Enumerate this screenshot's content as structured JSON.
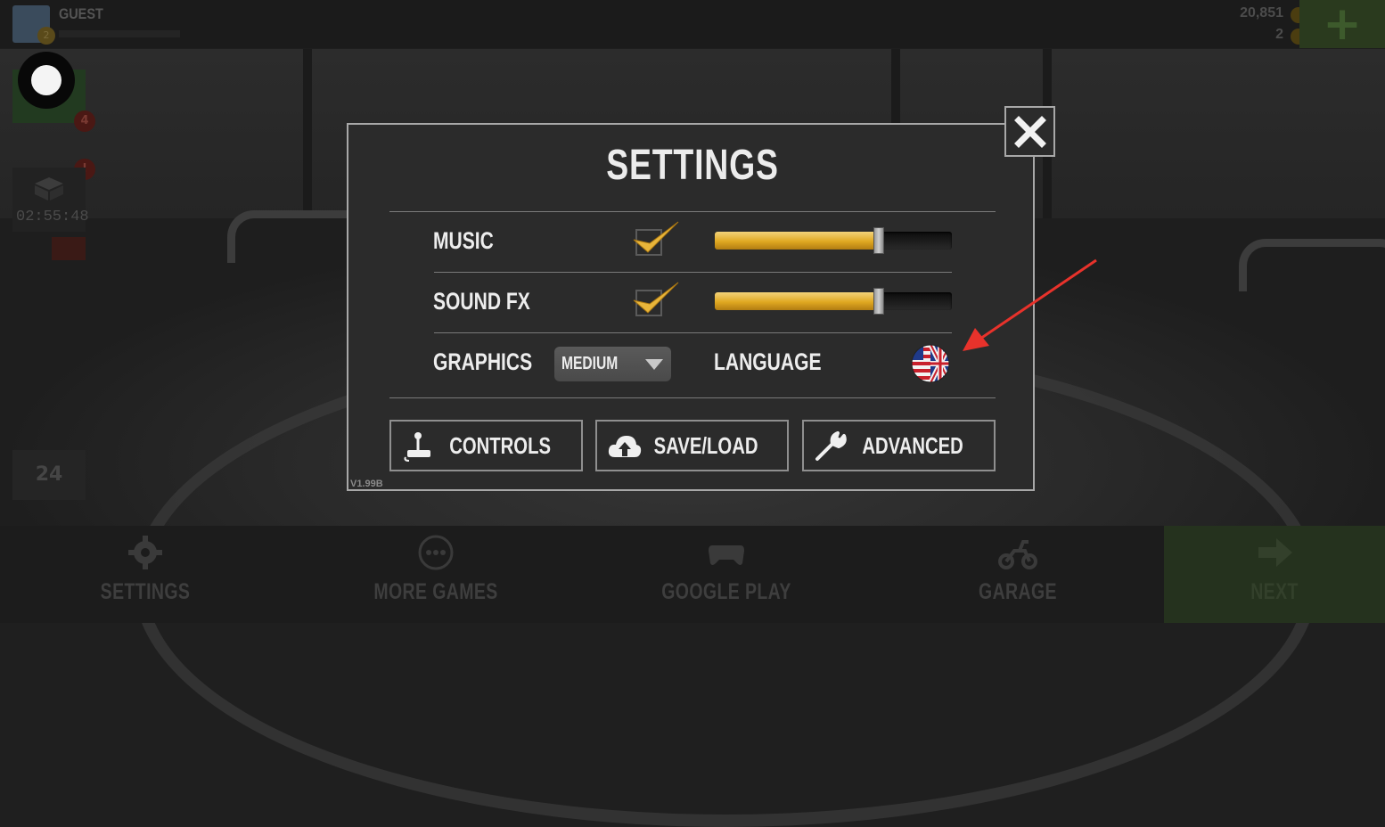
{
  "hud": {
    "player_name": "GUEST",
    "player_level": "2",
    "cash": "20,851",
    "gold": "2",
    "add_button_label": "+",
    "notif_count": "4",
    "notif_alert": "!",
    "crate_timer": "02:55:48",
    "daily_tile_label": "24"
  },
  "dialog": {
    "title": "SETTINGS",
    "music_label": "MUSIC",
    "music_enabled": true,
    "music_volume": 0.69,
    "soundfx_label": "SOUND FX",
    "soundfx_enabled": true,
    "soundfx_volume": 0.69,
    "graphics_label": "GRAPHICS",
    "graphics_value": "MEDIUM",
    "language_label": "LANGUAGE",
    "language_icon": "uk-us-flag-icon",
    "buttons": [
      {
        "label": "CONTROLS",
        "icon": "joystick-icon"
      },
      {
        "label": "SAVE/LOAD",
        "icon": "cloud-upload-icon"
      },
      {
        "label": "ADVANCED",
        "icon": "wrench-icon"
      }
    ],
    "version": "V1.99B",
    "close_icon": "close-icon"
  },
  "bottom_nav": [
    {
      "label": "SETTINGS",
      "icon": "gear-icon"
    },
    {
      "label": "MORE GAMES",
      "icon": "ellipsis-icon"
    },
    {
      "label": "GOOGLE PLAY",
      "icon": "gamepad-icon"
    },
    {
      "label": "GARAGE",
      "icon": "motorbike-icon"
    },
    {
      "label": "NEXT",
      "icon": "arrow-right-icon"
    }
  ],
  "colors": {
    "accent_gold": "#e0a821",
    "check_gold": "#e8b53a",
    "annotation_red": "#e8322b",
    "dialog_bg": "#2b2b2b",
    "dialog_border": "#a8a8a8"
  }
}
